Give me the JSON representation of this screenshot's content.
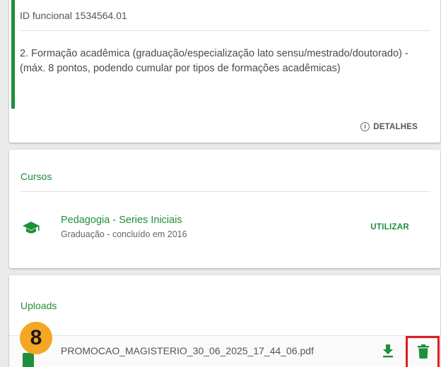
{
  "card1": {
    "id_text": "ID funcional 1534564.01",
    "description": "2. Formação acadêmica (graduação/especialização lato sensu/mestrado/doutorado) - (máx. 8 pontos, podendo cumular por tipos de formações acadêmicas)",
    "details_label": "DETALHES",
    "details_icon": "info-icon"
  },
  "courses": {
    "title": "Cursos",
    "items": [
      {
        "name": "Pedagogia - Series Iniciais",
        "subtitle": "Graduação - concluído em 2016",
        "action_label": "UTILIZAR",
        "icon": "graduation-cap-icon"
      }
    ]
  },
  "uploads": {
    "title": "Uploads",
    "files": [
      {
        "file_name": "PROMOCAO_MAGISTERIO_30_06_2025_17_44_06.pdf",
        "download_icon": "download-icon",
        "delete_icon": "trash-icon"
      }
    ]
  },
  "annotation": {
    "step_number": "8",
    "badge_color": "#f5a623",
    "highlight_color": "#e11a22"
  },
  "colors": {
    "accent": "#1e8f3b",
    "background": "#ebebeb",
    "card": "#ffffff"
  }
}
